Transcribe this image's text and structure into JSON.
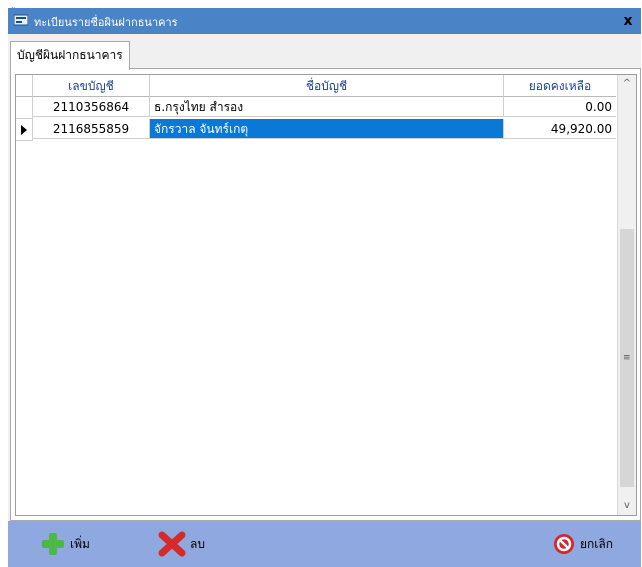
{
  "window": {
    "title": "ทะเบียนรายชื่อผินฝากธนาคาร",
    "close_glyph": "x",
    "top_glyph": "ู"
  },
  "tabs": [
    {
      "label": "บัญชีผินฝากธนาคาร"
    }
  ],
  "grid": {
    "columns": [
      "เลขบัญชี",
      "ชื่อบัญชี",
      "ยอดคงเหลือ"
    ],
    "rows": [
      {
        "account_no": "2110356864",
        "account_name": "ธ.กรุงไทย สำรอง",
        "balance": "0.00",
        "selected": false
      },
      {
        "account_no": "2116855859",
        "account_name": "จักรวาล จันทร์เกตุ",
        "balance": "49,920.00",
        "selected": true
      }
    ],
    "scroll_up": "^",
    "scroll_down": "v",
    "scroll_grip": "≡"
  },
  "footer": {
    "add_label": "เพิ่ม",
    "delete_label": "ลบ",
    "cancel_label": "ยกเลิก"
  },
  "colors": {
    "titlebar": "#4a84c7",
    "selection": "#0a78d7",
    "footer": "#8fa8df",
    "header_text": "#1f3f8f",
    "add_icon": "#4cb848",
    "delete_icon": "#d42a2a",
    "cancel_icon": "#d8242b"
  }
}
